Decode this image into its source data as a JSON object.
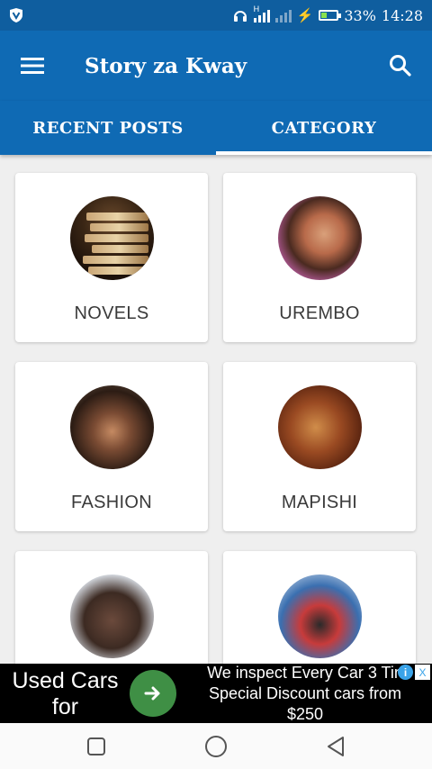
{
  "status_bar": {
    "signal_label": "H",
    "battery_text": "33%",
    "battery_level": 0.33,
    "time": "14:28"
  },
  "app_bar": {
    "title": "Story za Kway"
  },
  "tabs": [
    {
      "label": "RECENT POSTS",
      "active": false
    },
    {
      "label": "CATEGORY",
      "active": true
    }
  ],
  "categories": [
    {
      "label": "NOVELS",
      "icon": "books-image"
    },
    {
      "label": "UREMBO",
      "icon": "woman-portrait-image"
    },
    {
      "label": "FASHION",
      "icon": "group-photo-image"
    },
    {
      "label": "MAPISHI",
      "icon": "grilled-food-image"
    },
    {
      "label": "",
      "icon": "family-photo-image"
    },
    {
      "label": "",
      "icon": "family-show-image"
    }
  ],
  "ad": {
    "left_text_line1": "Used Cars",
    "left_text_line2": "for",
    "right_text_line1": "We inspect Every Car 3 Tin",
    "right_text_line2": "Special Discount cars from",
    "right_text_line3": "$250",
    "info_glyph": "i",
    "close_glyph": "X"
  },
  "colors": {
    "primary": "#0f6ab4",
    "status": "#0f5e9f",
    "ad_button": "#3f8f45"
  }
}
